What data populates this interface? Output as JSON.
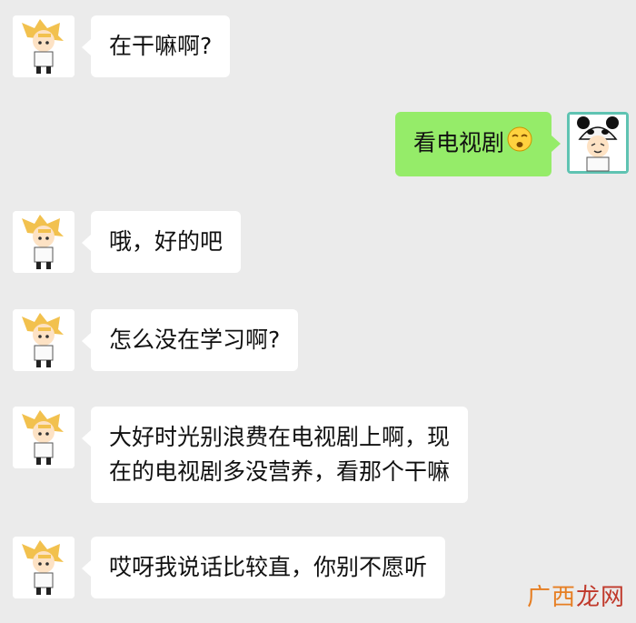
{
  "messages": [
    {
      "side": "left",
      "text": "在干嘛啊?"
    },
    {
      "side": "right",
      "text": "看电视剧",
      "emoji": "squinting-smile-emoji"
    },
    {
      "side": "left",
      "text": "哦，好的吧"
    },
    {
      "side": "left",
      "text": "怎么没在学习啊?"
    },
    {
      "side": "left",
      "lines": [
        "大好时光别浪费在电视剧上啊，现",
        "在的电视剧多没营养，看那个干嘛"
      ]
    },
    {
      "side": "left",
      "text": "哎呀我说话比较直，你别不愿听"
    }
  ],
  "watermark": {
    "part1": "广西",
    "part2": "龙网"
  },
  "colors": {
    "background": "#ebebeb",
    "left_bubble": "#ffffff",
    "right_bubble": "#95ec69",
    "watermark_a": "#e67e22",
    "watermark_b": "#c0392b"
  },
  "avatars": {
    "left": "blonde-chibi-avatar",
    "right": "panda-hat-boy-avatar"
  }
}
